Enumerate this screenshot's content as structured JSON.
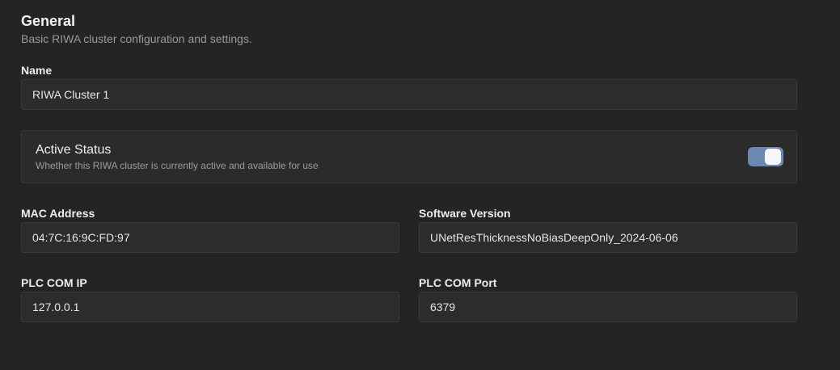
{
  "section": {
    "title": "General",
    "description": "Basic RIWA cluster configuration and settings."
  },
  "fields": {
    "name": {
      "label": "Name",
      "value": "RIWA Cluster 1"
    },
    "mac_address": {
      "label": "MAC Address",
      "value": "04:7C:16:9C:FD:97"
    },
    "software_version": {
      "label": "Software Version",
      "value": "UNetResThicknessNoBiasDeepOnly_2024-06-06"
    },
    "plc_com_ip": {
      "label": "PLC COM IP",
      "value": "127.0.0.1"
    },
    "plc_com_port": {
      "label": "PLC COM Port",
      "value": "6379"
    }
  },
  "active_status": {
    "title": "Active Status",
    "description": "Whether this RIWA cluster is currently active and available for use",
    "enabled": true
  },
  "colors": {
    "background": "#242424",
    "input_background": "#2c2c2c",
    "toggle_on": "#6c88b0"
  }
}
